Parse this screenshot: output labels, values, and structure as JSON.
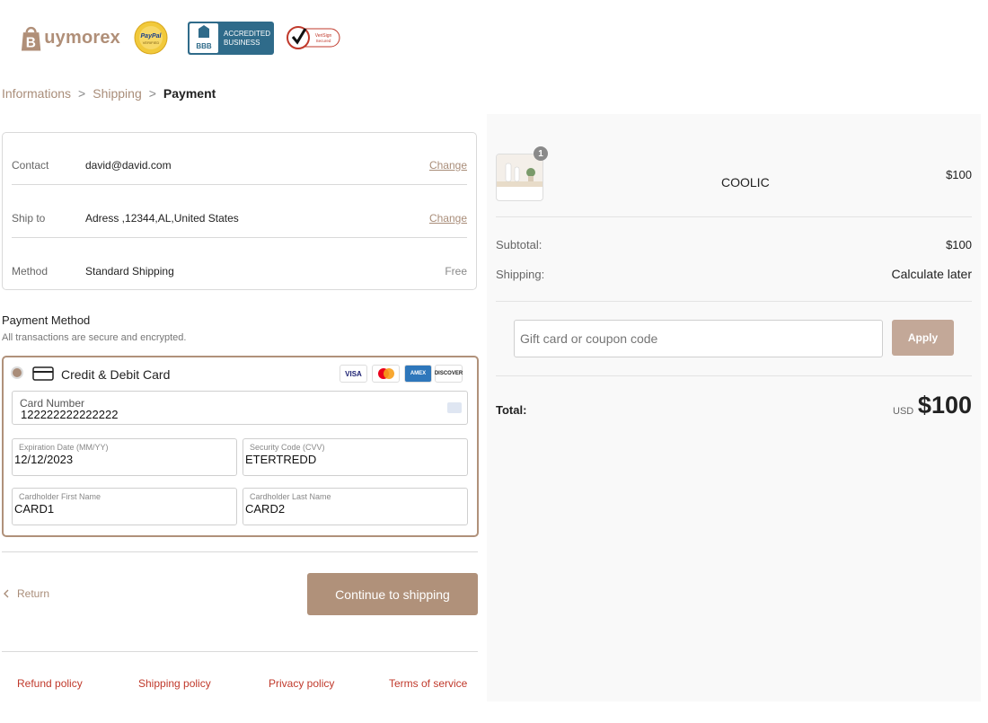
{
  "header": {
    "logo_text": "uymorex",
    "logo_initial": "B",
    "badges": {
      "paypal": "PayPal",
      "paypal_sub": "VERIFIED",
      "bbb_line1": "ACCREDITED",
      "bbb_line2": "BUSINESS",
      "bbb_logo": "BBB",
      "verisign_line1": "VeriSign",
      "verisign_line2": "Secured"
    }
  },
  "breadcrumb": {
    "items": [
      "Informations",
      "Shipping",
      "Payment"
    ],
    "separator": ">"
  },
  "info": {
    "contact": {
      "label": "Contact",
      "value": "david@david.com",
      "action": "Change"
    },
    "ship_to": {
      "label": "Ship to",
      "value": "Adress ,12344,AL,United States",
      "action": "Change"
    },
    "method": {
      "label": "Method",
      "value": "Standard Shipping",
      "action": "Free"
    }
  },
  "payment": {
    "title": "Payment Method",
    "subtitle": "All transactions are secure and encrypted.",
    "method_label": "Credit & Debit Card",
    "brands": [
      "VISA",
      "mastercard",
      "AMEX",
      "DISCOVER"
    ],
    "card_number": {
      "label": "Card Number",
      "value": "122222222222222"
    },
    "expiration": {
      "label": "Expiration Date (MM/YY)",
      "value": "12/12/2023"
    },
    "security": {
      "label": "Security Code (CVV)",
      "value": "ETERTREDD"
    },
    "first_name": {
      "label": "Cardholder First Name",
      "value": "CARD1"
    },
    "last_name": {
      "label": "Cardholder Last Name",
      "value": "CARD2"
    }
  },
  "actions": {
    "return_label": "Return",
    "continue_label": "Continue to shipping"
  },
  "footer": {
    "links": [
      "Refund policy",
      "Shipping policy",
      "Privacy policy",
      "Terms of service"
    ]
  },
  "summary": {
    "product": {
      "name": "COOLIC",
      "price": "$100",
      "quantity": "1"
    },
    "subtotal_label": "Subtotal:",
    "subtotal_value": "$100",
    "shipping_label": "Shipping:",
    "shipping_value": "Calculate later",
    "coupon_placeholder": "Gift card or coupon code",
    "apply_label": "Apply",
    "total_label": "Total:",
    "currency": "USD",
    "total_value": "$100"
  },
  "colors": {
    "accent": "#b0917a",
    "link": "#a98d79",
    "footer_link": "#c0392b",
    "summary_bg": "#f9f9f9"
  }
}
